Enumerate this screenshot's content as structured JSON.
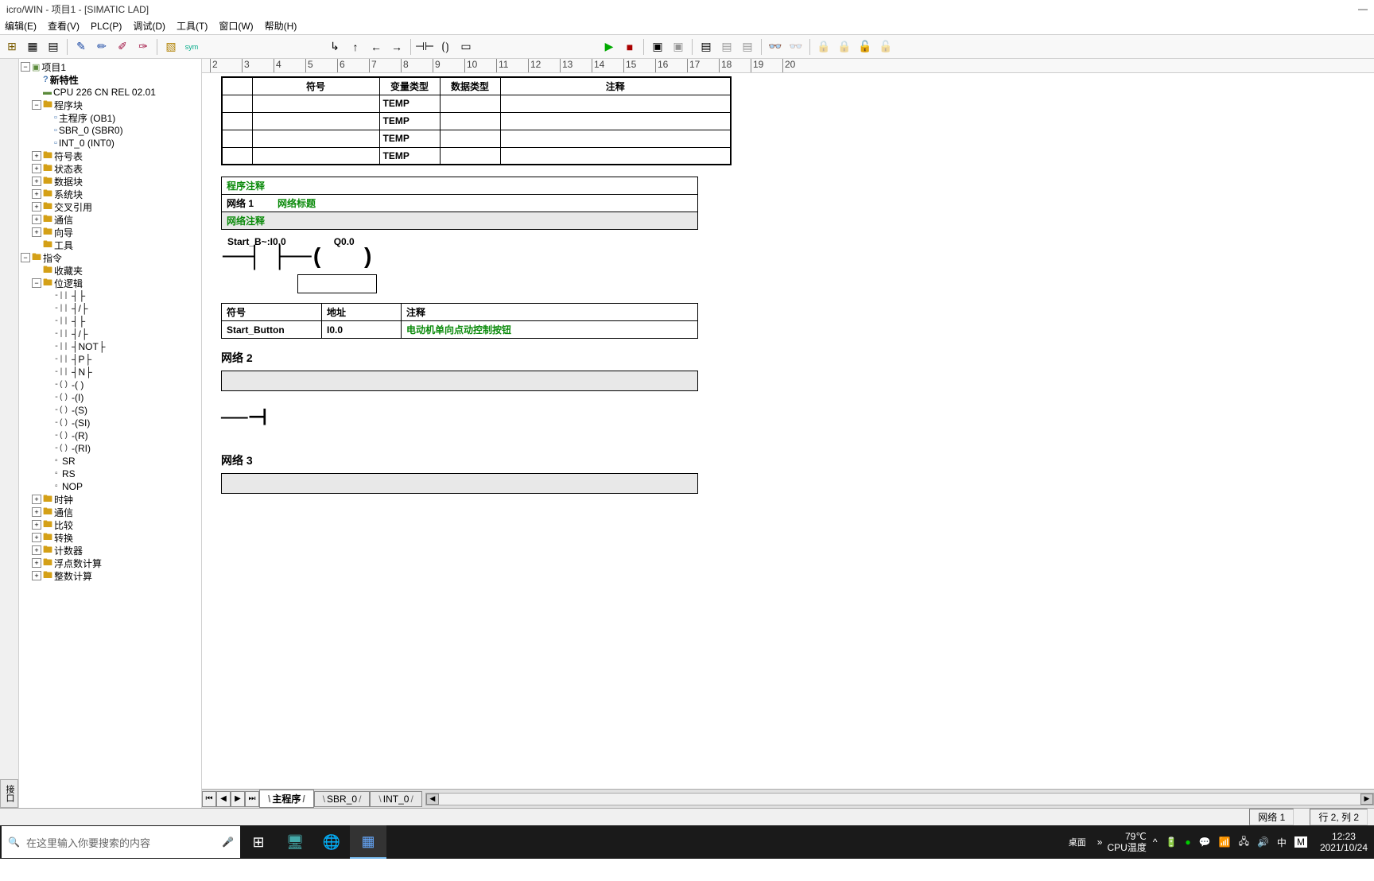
{
  "title": "icro/WIN - 项目1 - [SIMATIC LAD]",
  "menu": [
    "编辑(E)",
    "查看(V)",
    "PLC(P)",
    "调试(D)",
    "工具(T)",
    "窗口(W)",
    "帮助(H)"
  ],
  "left_tab": "接口",
  "tree": {
    "root": "项目1",
    "newprop": "新特性",
    "cpu": "CPU 226 CN REL 02.01",
    "progblock": "程序块",
    "prog_items": [
      "主程序 (OB1)",
      "SBR_0 (SBR0)",
      "INT_0 (INT0)"
    ],
    "folders": [
      "符号表",
      "状态表",
      "数据块",
      "系统块",
      "交叉引用",
      "通信",
      "向导",
      "工具"
    ],
    "instr": "指令",
    "fav": "收藏夹",
    "bitlogic": "位逻辑",
    "bit_items": [
      "┤├",
      "┤/├",
      "┤├",
      "┤/├",
      "┤NOT├",
      "┤P├",
      "┤N├",
      "-( )",
      "-(I)",
      "-(S)",
      "-(SI)",
      "-(R)",
      "-(RI)",
      "SR",
      "RS",
      "NOP"
    ],
    "instr_folders": [
      "时钟",
      "通信",
      "比较",
      "转换",
      "计数器",
      "浮点数计算",
      "整数计算"
    ]
  },
  "var_table": {
    "headers": [
      "符号",
      "变量类型",
      "数据类型",
      "注释"
    ],
    "rows": [
      "TEMP",
      "TEMP",
      "TEMP",
      "TEMP"
    ]
  },
  "prog_comment": "程序注释",
  "net1": {
    "no": "网络 1",
    "title": "网络标题",
    "comment": "网络注释"
  },
  "ladder": {
    "in": "Start_B~:I0.0",
    "out": "Q0.0"
  },
  "sym_table": {
    "headers": [
      "符号",
      "地址",
      "注释"
    ],
    "row": [
      "Start_Button",
      "I0.0",
      "电动机单向点动控制按钮"
    ]
  },
  "net2": "网络 2",
  "net3": "网络 3",
  "tabs": [
    "主程序",
    "SBR_0",
    "INT_0"
  ],
  "status": {
    "net": "网络 1",
    "pos": "行 2, 列 2"
  },
  "taskbar": {
    "search": "在这里输入你要搜索的内容",
    "desktop": "桌面",
    "temp": "79℃",
    "templbl": "CPU温度",
    "ime": "中",
    "time": "12:23",
    "date": "2021/10/24"
  }
}
